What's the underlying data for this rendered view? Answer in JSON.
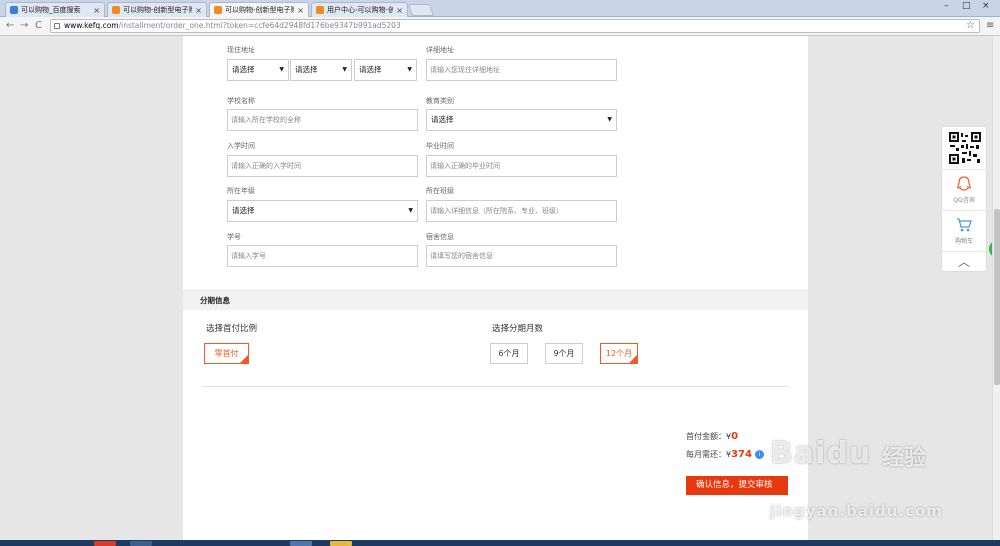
{
  "browser": {
    "tabs": [
      {
        "title": "可以购物_百度搜索",
        "icon": "baidu-icon"
      },
      {
        "title": "可以购物-创新型电子购物",
        "icon": "shop-icon"
      },
      {
        "title": "可以购物-创新型电子购物",
        "icon": "shop-icon",
        "active": true
      },
      {
        "title": "用户中心-可以购物-创新",
        "icon": "shop-icon"
      }
    ],
    "close_glyph": "×",
    "url_host": "www.kefq.com",
    "url_path": "/installment/order_one.html?token=ccfe64d2948fd176be9347b991ad5203",
    "nav": {
      "back": "←",
      "forward": "→",
      "reload": "C"
    },
    "window_controls": {
      "min": "–",
      "max": "□",
      "close": "×"
    },
    "star": "☆",
    "menu": "≡"
  },
  "form": {
    "address": {
      "label": "现住地址",
      "province": "请选择",
      "city": "请选择",
      "district": "请选择",
      "detail_label": "详细地址",
      "detail_placeholder": "请输入您现住详细地址"
    },
    "school": {
      "label": "学校名称",
      "placeholder": "请输入所在学校的全称"
    },
    "education": {
      "label": "教育类别",
      "value": "请选择"
    },
    "enroll": {
      "label": "入学时间",
      "placeholder": "请输入正确的入学时间"
    },
    "graduate": {
      "label": "毕业时间",
      "placeholder": "请输入正确的毕业时间"
    },
    "grade": {
      "label": "所在年级",
      "value": "请选择"
    },
    "class": {
      "label": "所在班级",
      "placeholder": "请输入详细信息（所在院系、专业、班级）"
    },
    "student_id": {
      "label": "学号",
      "placeholder": "请输入学号"
    },
    "dorm": {
      "label": "宿舍信息",
      "placeholder": "请填写您的宿舍信息"
    }
  },
  "installment": {
    "section_title": "分期信息",
    "down_payment_title": "选择首付比例",
    "down_payment_options": [
      "零首付"
    ],
    "months_title": "选择分期月数",
    "months_options": [
      "6个月",
      "9个月",
      "12个月"
    ],
    "months_selected": 2
  },
  "summary": {
    "down_label": "首付金额：",
    "down_currency": "¥",
    "down_value": "0",
    "monthly_label": "每月需还：",
    "monthly_currency": "¥",
    "monthly_value": "374",
    "info_icon": "i",
    "submit_label": "确认信息，提交审核"
  },
  "float_panel": {
    "qq_label": "QQ咨询",
    "cart_label": "购物车",
    "top_glyph": "︿"
  },
  "watermark": {
    "brand": "Baidu",
    "cn": "经验",
    "url": "jingyan.baidu.com"
  },
  "colors": {
    "accent": "#f15a24",
    "button": "#e8380d",
    "info": "#3c8ee8"
  }
}
